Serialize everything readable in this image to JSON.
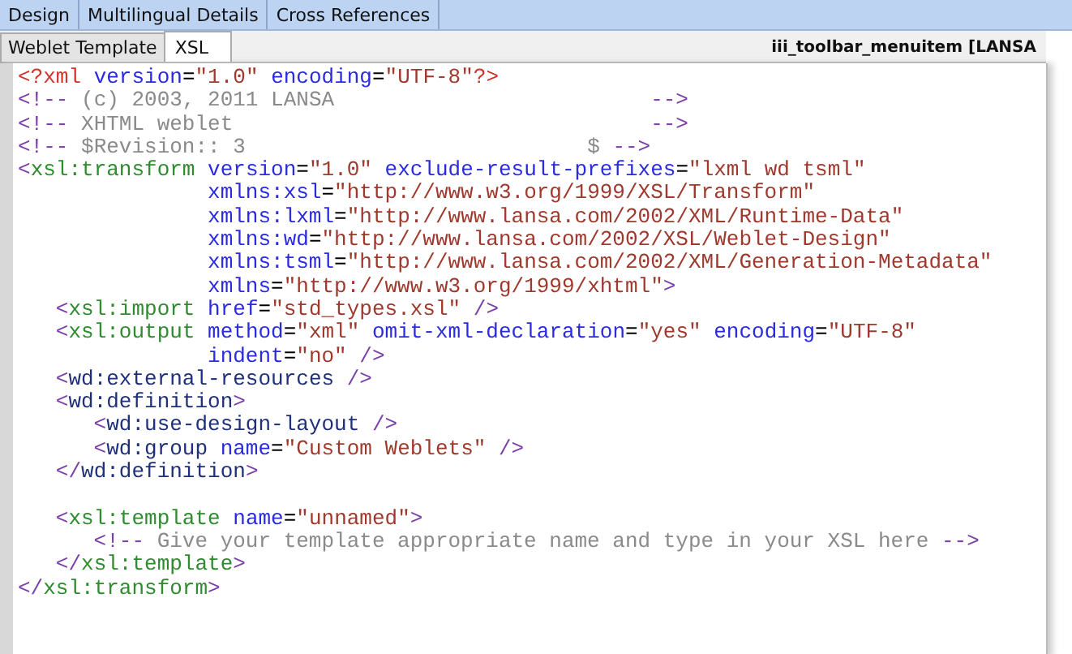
{
  "top_tabs": [
    {
      "label": "Design",
      "selected": false
    },
    {
      "label": "Multilingual Details",
      "selected": false
    },
    {
      "label": "Cross References",
      "selected": false
    }
  ],
  "editor_tabs": [
    {
      "label": "Weblet Template",
      "selected": false
    },
    {
      "label": "XSL",
      "selected": true
    }
  ],
  "document_title": "iii_toolbar_menuitem [LANSA",
  "code": {
    "blocks": [
      [
        [
          {
            "kind": "pi",
            "text": "<?xml"
          },
          {
            "kind": "attr",
            "text": " version"
          },
          {
            "kind": "plain",
            "text": "="
          },
          {
            "kind": "value",
            "text": "\"1.0\""
          },
          {
            "kind": "attr",
            "text": " encoding"
          },
          {
            "kind": "plain",
            "text": "="
          },
          {
            "kind": "value",
            "text": "\"UTF-8\""
          },
          {
            "kind": "pi",
            "text": "?>"
          }
        ],
        [
          {
            "kind": "bracket",
            "text": "<!--"
          },
          {
            "kind": "comment",
            "text": " (c) 2003, 2011 LANSA                         "
          },
          {
            "kind": "bracket",
            "text": "-->"
          }
        ],
        [
          {
            "kind": "bracket",
            "text": "<!--"
          },
          {
            "kind": "comment",
            "text": " XHTML weblet                                 "
          },
          {
            "kind": "bracket",
            "text": "-->"
          }
        ],
        [
          {
            "kind": "bracket",
            "text": "<!--"
          },
          {
            "kind": "comment",
            "text": " $Revision:: 3                           $ "
          },
          {
            "kind": "bracket",
            "text": "-->"
          }
        ],
        [
          {
            "kind": "bracket",
            "text": "<"
          },
          {
            "kind": "xsl",
            "text": "xsl:transform"
          },
          {
            "kind": "attr",
            "text": " version"
          },
          {
            "kind": "plain",
            "text": "="
          },
          {
            "kind": "value",
            "text": "\"1.0\""
          },
          {
            "kind": "attr",
            "text": " exclude-result-prefixes"
          },
          {
            "kind": "plain",
            "text": "="
          },
          {
            "kind": "value",
            "text": "\"lxml wd tsml\""
          }
        ],
        [
          {
            "kind": "attr",
            "text": "               xmlns:xsl"
          },
          {
            "kind": "plain",
            "text": "="
          },
          {
            "kind": "value",
            "text": "\"http://www.w3.org/1999/XSL/Transform\""
          }
        ],
        [
          {
            "kind": "attr",
            "text": "               xmlns:lxml"
          },
          {
            "kind": "plain",
            "text": "="
          },
          {
            "kind": "value",
            "text": "\"http://www.lansa.com/2002/XML/Runtime-Data\""
          }
        ],
        [
          {
            "kind": "attr",
            "text": "               xmlns:wd"
          },
          {
            "kind": "plain",
            "text": "="
          },
          {
            "kind": "value",
            "text": "\"http://www.lansa.com/2002/XSL/Weblet-Design\""
          }
        ],
        [
          {
            "kind": "attr",
            "text": "               xmlns:tsml"
          },
          {
            "kind": "plain",
            "text": "="
          },
          {
            "kind": "value",
            "text": "\"http://www.lansa.com/2002/XML/Generation-Metadata\""
          }
        ],
        [
          {
            "kind": "attr",
            "text": "               xmlns"
          },
          {
            "kind": "plain",
            "text": "="
          },
          {
            "kind": "value",
            "text": "\"http://www.w3.org/1999/xhtml\""
          },
          {
            "kind": "bracket",
            "text": ">"
          }
        ],
        [
          {
            "kind": "bracket",
            "text": "   <"
          },
          {
            "kind": "xsl",
            "text": "xsl:import"
          },
          {
            "kind": "attr",
            "text": " href"
          },
          {
            "kind": "plain",
            "text": "="
          },
          {
            "kind": "value",
            "text": "\"std_types.xsl\""
          },
          {
            "kind": "bracket",
            "text": " />"
          }
        ],
        [
          {
            "kind": "bracket",
            "text": "   <"
          },
          {
            "kind": "xsl",
            "text": "xsl:output"
          },
          {
            "kind": "attr",
            "text": " method"
          },
          {
            "kind": "plain",
            "text": "="
          },
          {
            "kind": "value",
            "text": "\"xml\""
          },
          {
            "kind": "attr",
            "text": " omit-xml-declaration"
          },
          {
            "kind": "plain",
            "text": "="
          },
          {
            "kind": "value",
            "text": "\"yes\""
          },
          {
            "kind": "attr",
            "text": " encoding"
          },
          {
            "kind": "plain",
            "text": "="
          },
          {
            "kind": "value",
            "text": "\"UTF-8\""
          }
        ],
        [
          {
            "kind": "attr",
            "text": "               indent"
          },
          {
            "kind": "plain",
            "text": "="
          },
          {
            "kind": "value",
            "text": "\"no\""
          },
          {
            "kind": "bracket",
            "text": " />"
          }
        ],
        [
          {
            "kind": "bracket",
            "text": "   <"
          },
          {
            "kind": "wd",
            "text": "wd:external-resources"
          },
          {
            "kind": "bracket",
            "text": " />"
          }
        ],
        [
          {
            "kind": "bracket",
            "text": "   <"
          },
          {
            "kind": "wd",
            "text": "wd:definition"
          },
          {
            "kind": "bracket",
            "text": ">"
          }
        ],
        [
          {
            "kind": "bracket",
            "text": "      <"
          },
          {
            "kind": "wd",
            "text": "wd:use-design-layout"
          },
          {
            "kind": "bracket",
            "text": " />"
          }
        ],
        [
          {
            "kind": "bracket",
            "text": "      <"
          },
          {
            "kind": "wd",
            "text": "wd:group"
          },
          {
            "kind": "attr",
            "text": " name"
          },
          {
            "kind": "plain",
            "text": "="
          },
          {
            "kind": "value",
            "text": "\"Custom Weblets\""
          },
          {
            "kind": "bracket",
            "text": " />"
          }
        ],
        [
          {
            "kind": "bracket",
            "text": "   </"
          },
          {
            "kind": "wd",
            "text": "wd:definition"
          },
          {
            "kind": "bracket",
            "text": ">"
          }
        ]
      ],
      [
        [
          {
            "kind": "bracket",
            "text": "   <"
          },
          {
            "kind": "xsl",
            "text": "xsl:template"
          },
          {
            "kind": "attr",
            "text": " name"
          },
          {
            "kind": "plain",
            "text": "="
          },
          {
            "kind": "value",
            "text": "\"unnamed\""
          },
          {
            "kind": "bracket",
            "text": ">"
          }
        ],
        [
          {
            "kind": "bracket",
            "text": "      <!--"
          },
          {
            "kind": "comment",
            "text": " Give your template appropriate name and type in your XSL here "
          },
          {
            "kind": "bracket",
            "text": "-->"
          }
        ],
        [
          {
            "kind": "bracket",
            "text": "   </"
          },
          {
            "kind": "xsl",
            "text": "xsl:template"
          },
          {
            "kind": "bracket",
            "text": ">"
          }
        ],
        [
          {
            "kind": "bracket",
            "text": "</"
          },
          {
            "kind": "xsl",
            "text": "xsl:transform"
          },
          {
            "kind": "bracket",
            "text": ">"
          }
        ]
      ]
    ]
  }
}
